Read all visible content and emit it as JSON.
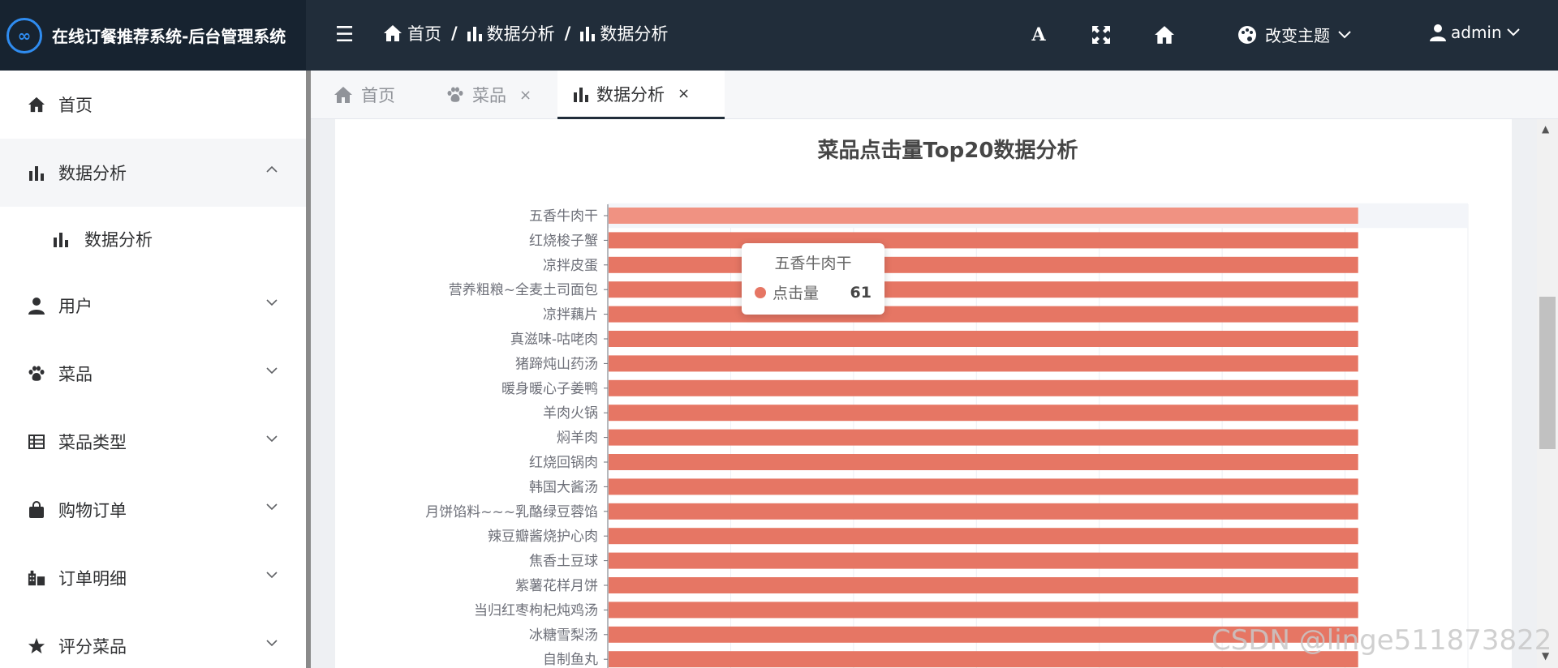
{
  "app": {
    "title": "在线订餐推荐系统-后台管理系统",
    "logo_glyph": "∞"
  },
  "breadcrumb": [
    "首页",
    "数据分析",
    "数据分析"
  ],
  "header": {
    "theme_label": "改变主题",
    "user_label": "admin"
  },
  "sidebar": {
    "items": [
      {
        "label": "首页",
        "icon": "home-icon"
      },
      {
        "label": "数据分析",
        "icon": "bar-chart-icon"
      },
      {
        "label": "用户",
        "icon": "user-icon"
      },
      {
        "label": "菜品",
        "icon": "paw-icon"
      },
      {
        "label": "菜品类型",
        "icon": "list-icon"
      },
      {
        "label": "购物订单",
        "icon": "bag-icon"
      },
      {
        "label": "订单明细",
        "icon": "building-icon"
      },
      {
        "label": "评分菜品",
        "icon": "star-icon"
      }
    ],
    "sub_item": "数据分析"
  },
  "tabs": [
    {
      "label": "首页"
    },
    {
      "label": "菜品"
    },
    {
      "label": "数据分析"
    }
  ],
  "tooltip": {
    "title": "五香牛肉干",
    "series": "点击量",
    "value": "61"
  },
  "watermark": "CSDN @linge511873822",
  "colors": {
    "bar": "#e67664",
    "bar_highlight": "#f09282",
    "topbar": "#212d3a"
  },
  "chart_data": {
    "type": "bar",
    "orientation": "horizontal",
    "title": "菜品点击量Top20数据分析",
    "categories": [
      "五香牛肉干",
      "红烧梭子蟹",
      "凉拌皮蛋",
      "营养粗粮~全麦土司面包",
      "凉拌藕片",
      "真滋味-咕咾肉",
      "猪蹄炖山药汤",
      "暖身暖心子姜鸭",
      "羊肉火锅",
      "焖羊肉",
      "红烧回锅肉",
      "韩国大酱汤",
      "月饼馅料~~~乳酪绿豆蓉馅",
      "辣豆瓣酱烧护心肉",
      "焦香土豆球",
      "紫薯花样月饼",
      "当归红枣枸杞炖鸡汤",
      "冰糖雪梨汤",
      "自制鱼丸"
    ],
    "series": [
      {
        "name": "点击量",
        "values": [
          61,
          61,
          61,
          61,
          61,
          61,
          61,
          61,
          61,
          61,
          61,
          61,
          61,
          61,
          61,
          61,
          61,
          61,
          61
        ]
      }
    ],
    "xlim": [
      0,
      70
    ],
    "highlight_index": 0,
    "grid": true
  }
}
